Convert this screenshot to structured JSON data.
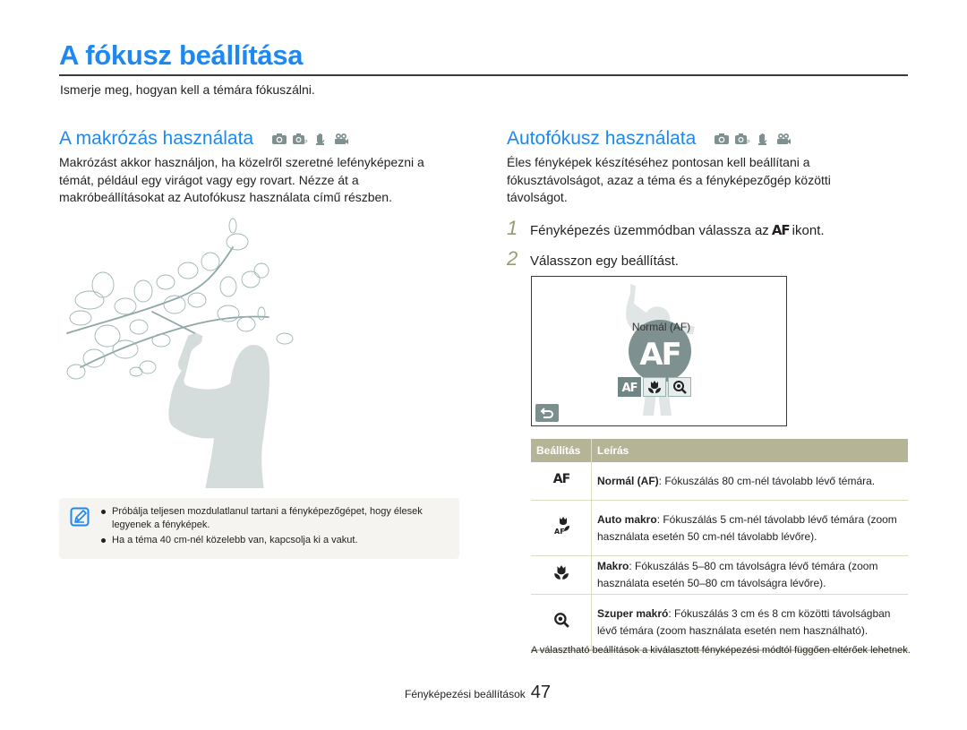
{
  "page": {
    "title": "A fókusz beállítása",
    "subtitle": "Ismerje meg, hogyan kell a témára fókuszálni."
  },
  "macro_section": {
    "heading": "A makrózás használata",
    "mode_icons": [
      "camera-icon",
      "program-camera-icon",
      "dual-is-hand-icon",
      "movie-camera-icon"
    ],
    "body": "Makrózást akkor használjon, ha közelről szeretné lefényképezni a témát, például egy virágot vagy egy rovart. Nézze át a makróbeállításokat az Autofókusz használata című részben.",
    "illustration": "woman-photographing-magnolia-illustration",
    "note": {
      "icon": "note-pencil-icon",
      "items": [
        "Próbálja teljesen mozdulatlanul tartani a fényképezőgépet, hogy élesek legyenek a fényképek.",
        "Ha a téma 40 cm-nél közelebb van, kapcsolja ki a vakut."
      ]
    }
  },
  "af_section": {
    "heading": "Autofókusz használata",
    "mode_icons": [
      "camera-icon",
      "program-camera-icon",
      "dual-is-hand-icon",
      "movie-camera-icon"
    ],
    "body": "Éles fényképek készítéséhez pontosan kell beállítani a fókusztávolságot, azaz a téma és a fényképezőgép közötti távolságot.",
    "steps": [
      {
        "num": "1",
        "text_before": "Fényképezés üzemmódban válassza az",
        "icon_text": "AF",
        "text_after": "ikont."
      },
      {
        "num": "2",
        "text_before": "Válasszon egy beállítást.",
        "icon_text": "",
        "text_after": ""
      }
    ],
    "screen": {
      "mode_label": "Normál (AF)",
      "big_icon_text": "AF",
      "options": [
        {
          "name": "af",
          "label": "AF",
          "selected": true
        },
        {
          "name": "macro",
          "label": "",
          "selected": false
        },
        {
          "name": "super-macro",
          "label": "",
          "selected": false
        }
      ],
      "back_icon": "back-arrow-icon"
    },
    "table": {
      "headers": [
        "Beállítás",
        "Leírás"
      ],
      "rows": [
        {
          "icon": "af-icon",
          "icon_text": "AF",
          "term": "Normál (AF)",
          "desc": ": Fókuszálás 80 cm-nél távolabb lévő témára."
        },
        {
          "icon": "auto-macro-icon",
          "icon_text": "",
          "term": "Auto makro",
          "desc": ": Fókuszálás 5 cm-nél távolabb lévő témára (zoom használata esetén 50 cm-nél távolabb lévőre)."
        },
        {
          "icon": "macro-flower-icon",
          "icon_text": "",
          "term": "Makro",
          "desc": ": Fókuszálás 5–80 cm távolságra lévő témára (zoom használata esetén 50–80 cm távolságra lévőre)."
        },
        {
          "icon": "super-macro-magnifier-icon",
          "icon_text": "",
          "term": "Szuper makró",
          "desc": ": Fókuszálás 3 cm és 8 cm közötti távolságban lévő témára (zoom használata esetén nem használható)."
        }
      ],
      "note": "A választható beállítások a kiválasztott fényképezési módtól függően eltérőek lehetnek."
    }
  },
  "footer": {
    "section_label": "Fényképezési beállítások",
    "page_number": "47"
  },
  "colors": {
    "accent_blue": "#1e88f0",
    "table_header": "#b5b496",
    "step_number": "#9a9b6d",
    "icon_gray": "#7e9190"
  }
}
